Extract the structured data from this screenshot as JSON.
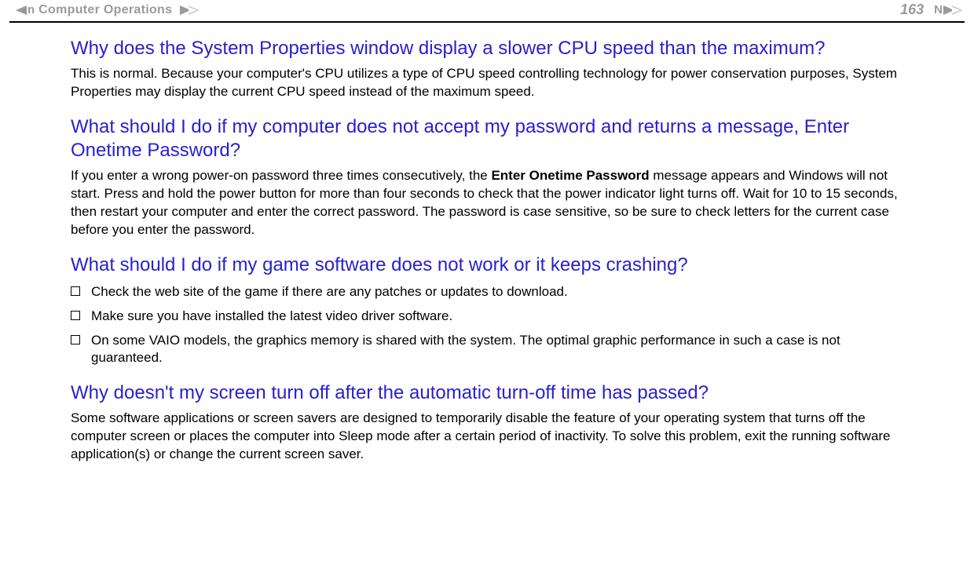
{
  "header": {
    "breadcrumb": "Computer Operations",
    "nav_n": "n",
    "page_number": "163",
    "nav_N_right": "N"
  },
  "sections": [
    {
      "heading": "Why does the System Properties window display a slower CPU speed than the maximum?",
      "body": "This is normal. Because your computer's CPU utilizes a type of CPU speed controlling technology for power conservation purposes, System Properties may display the current CPU speed instead of the maximum speed."
    },
    {
      "heading": "What should I do if my computer does not accept my password and returns a message, Enter Onetime Password?",
      "body_pre": "If you enter a wrong power-on password three times consecutively, the ",
      "body_bold": "Enter Onetime Password",
      "body_post": " message appears and Windows will not start. Press and hold the power button for more than four seconds to check that the power indicator light turns off. Wait for 10 to 15 seconds, then restart your computer and enter the correct password. The password is case sensitive, so be sure to check letters for the current case before you enter the password."
    },
    {
      "heading": "What should I do if my game software does not work or it keeps crashing?",
      "list": [
        "Check the web site of the game if there are any patches or updates to download.",
        "Make sure you have installed the latest video driver software.",
        "On some VAIO models, the graphics memory is shared with the system. The optimal graphic performance in such a case is not guaranteed."
      ]
    },
    {
      "heading": "Why doesn't my screen turn off after the automatic turn-off time has passed?",
      "body": "Some software applications or screen savers are designed to temporarily disable the feature of your operating system that turns off the computer screen or places the computer into Sleep mode after a certain period of inactivity. To solve this problem, exit the running software application(s) or change the current screen saver."
    }
  ]
}
